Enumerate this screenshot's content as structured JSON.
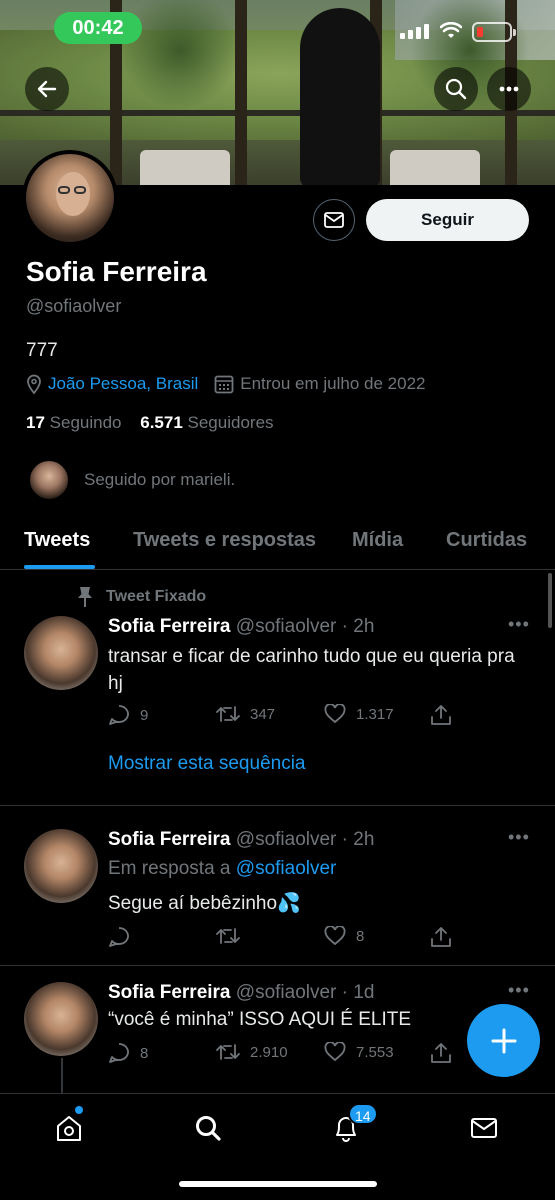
{
  "status_bar": {
    "time": "00:42"
  },
  "header": {
    "back_icon": "arrow-left-icon",
    "search_icon": "search-icon",
    "more_icon": "more-horizontal-icon"
  },
  "profile": {
    "name": "Sofia Ferreira",
    "handle": "@sofiaolver",
    "bio": "777",
    "location": "João Pessoa, Brasil",
    "joined": "Entrou em julho de 2022",
    "following_count": "17",
    "following_label": "Seguindo",
    "followers_count": "6.571",
    "followers_label": "Seguidores",
    "followed_by": "Seguido por marieli.",
    "follow_button": "Seguir"
  },
  "tabs": [
    {
      "label": "Tweets",
      "active": true
    },
    {
      "label": "Tweets e respostas",
      "active": false
    },
    {
      "label": "Mídia",
      "active": false
    },
    {
      "label": "Curtidas",
      "active": false
    }
  ],
  "tweets": [
    {
      "pinned_label": "Tweet Fixado",
      "name": "Sofia Ferreira",
      "meta": "@sofiaolver · 2h",
      "text": "transar e ficar de carinho tudo que eu queria pra hj",
      "replies": "9",
      "retweets": "347",
      "likes": "1.317",
      "show_thread": "Mostrar esta sequência"
    },
    {
      "name": "Sofia Ferreira",
      "meta": "@sofiaolver · 2h",
      "reply_prefix": "Em resposta a",
      "reply_to": "@sofiaolver",
      "text": "Segue aí bebêzinho💦",
      "replies": "",
      "retweets": "",
      "likes": "8"
    },
    {
      "name": "Sofia Ferreira",
      "meta": "@sofiaolver · 1d",
      "text": "“você é minha” ISSO AQUI É ELITE",
      "replies": "8",
      "retweets": "2.910",
      "likes": "7.553"
    }
  ],
  "bottom_nav": {
    "notifications_badge": "14"
  },
  "colors": {
    "accent": "#1d9bf0",
    "background": "#000000",
    "secondary_text": "#71767b"
  }
}
